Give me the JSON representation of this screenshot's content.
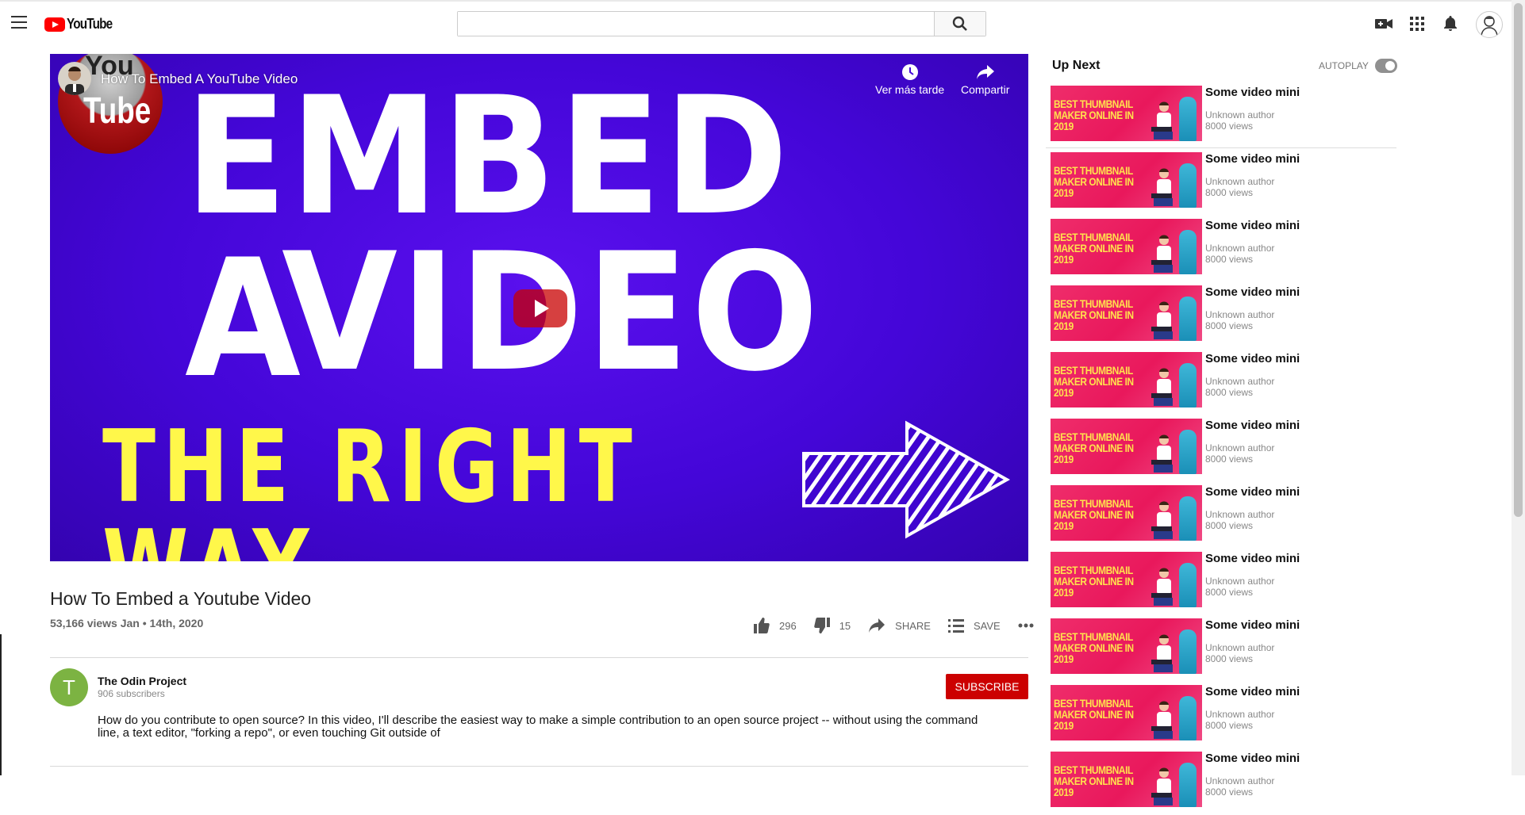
{
  "header": {
    "logo_text": "YouTube",
    "search_placeholder": "",
    "search_value": ""
  },
  "player": {
    "channel_logo_top": "You",
    "channel_logo_bottom": "Tube",
    "overlay_title": "How To Embed A YouTube Video",
    "watch_later_label": "Ver más tarde",
    "share_label": "Compartir",
    "thumbnail_line1": "EMBED A",
    "thumbnail_line2": "VIDEO",
    "thumbnail_line3": "THE RIGHT WAY"
  },
  "video": {
    "title": "How To Embed a Youtube Video",
    "meta": "53,166 views Jan • 14th, 2020",
    "likes": "296",
    "dislikes": "15",
    "share_label": "SHARE",
    "save_label": "SAVE"
  },
  "channel": {
    "initial": "T",
    "name": "The Odin Project",
    "subscribers": "906 subscribers",
    "subscribe_label": "SUBSCRIBE",
    "description": "How do you contribute to open source? In this video, I'll describe the easiest way to make a simple contribution to an open source project -- without using the command line, a text editor, \"forking a repo\", or even touching Git outside of"
  },
  "upnext": {
    "title": "Up Next",
    "autoplay_label": "AUTOPLAY",
    "autoplay_on": true,
    "items": [
      {
        "thumb_text": "BEST THUMBNAIL MAKER ONLINE IN 2019",
        "title": "Some video mini",
        "author": "Unknown author",
        "views": "8000 views"
      },
      {
        "thumb_text": "BEST THUMBNAIL MAKER ONLINE IN 2019",
        "title": "Some video mini",
        "author": "Unknown author",
        "views": "8000 views"
      },
      {
        "thumb_text": "BEST THUMBNAIL MAKER ONLINE IN 2019",
        "title": "Some video mini",
        "author": "Unknown author",
        "views": "8000 views"
      },
      {
        "thumb_text": "BEST THUMBNAIL MAKER ONLINE IN 2019",
        "title": "Some video mini",
        "author": "Unknown author",
        "views": "8000 views"
      },
      {
        "thumb_text": "BEST THUMBNAIL MAKER ONLINE IN 2019",
        "title": "Some video mini",
        "author": "Unknown author",
        "views": "8000 views"
      },
      {
        "thumb_text": "BEST THUMBNAIL MAKER ONLINE IN 2019",
        "title": "Some video mini",
        "author": "Unknown author",
        "views": "8000 views"
      },
      {
        "thumb_text": "BEST THUMBNAIL MAKER ONLINE IN 2019",
        "title": "Some video mini",
        "author": "Unknown author",
        "views": "8000 views"
      },
      {
        "thumb_text": "BEST THUMBNAIL MAKER ONLINE IN 2019",
        "title": "Some video mini",
        "author": "Unknown author",
        "views": "8000 views"
      },
      {
        "thumb_text": "BEST THUMBNAIL MAKER ONLINE IN 2019",
        "title": "Some video mini",
        "author": "Unknown author",
        "views": "8000 views"
      },
      {
        "thumb_text": "BEST THUMBNAIL MAKER ONLINE IN 2019",
        "title": "Some video mini",
        "author": "Unknown author",
        "views": "8000 views"
      },
      {
        "thumb_text": "BEST THUMBNAIL MAKER ONLINE IN 2019",
        "title": "Some video mini",
        "author": "Unknown author",
        "views": "8000 views"
      }
    ]
  },
  "colors": {
    "brand_red": "#ff0000",
    "subscribe_red": "#cc0000",
    "player_purple": "#4406d8",
    "thumb_pink": "#e9185c",
    "thumb_yellow": "#ffe14d",
    "channel_green": "#7cb342"
  },
  "icons": [
    "menu-icon",
    "youtube-logo-icon",
    "search-icon",
    "video-camera-icon",
    "apps-icon",
    "bell-icon",
    "account-icon",
    "clock-icon",
    "share-arrow-icon",
    "play-icon",
    "thumbs-up-icon",
    "thumbs-down-icon",
    "share-icon",
    "playlist-add-icon",
    "more-icon"
  ]
}
